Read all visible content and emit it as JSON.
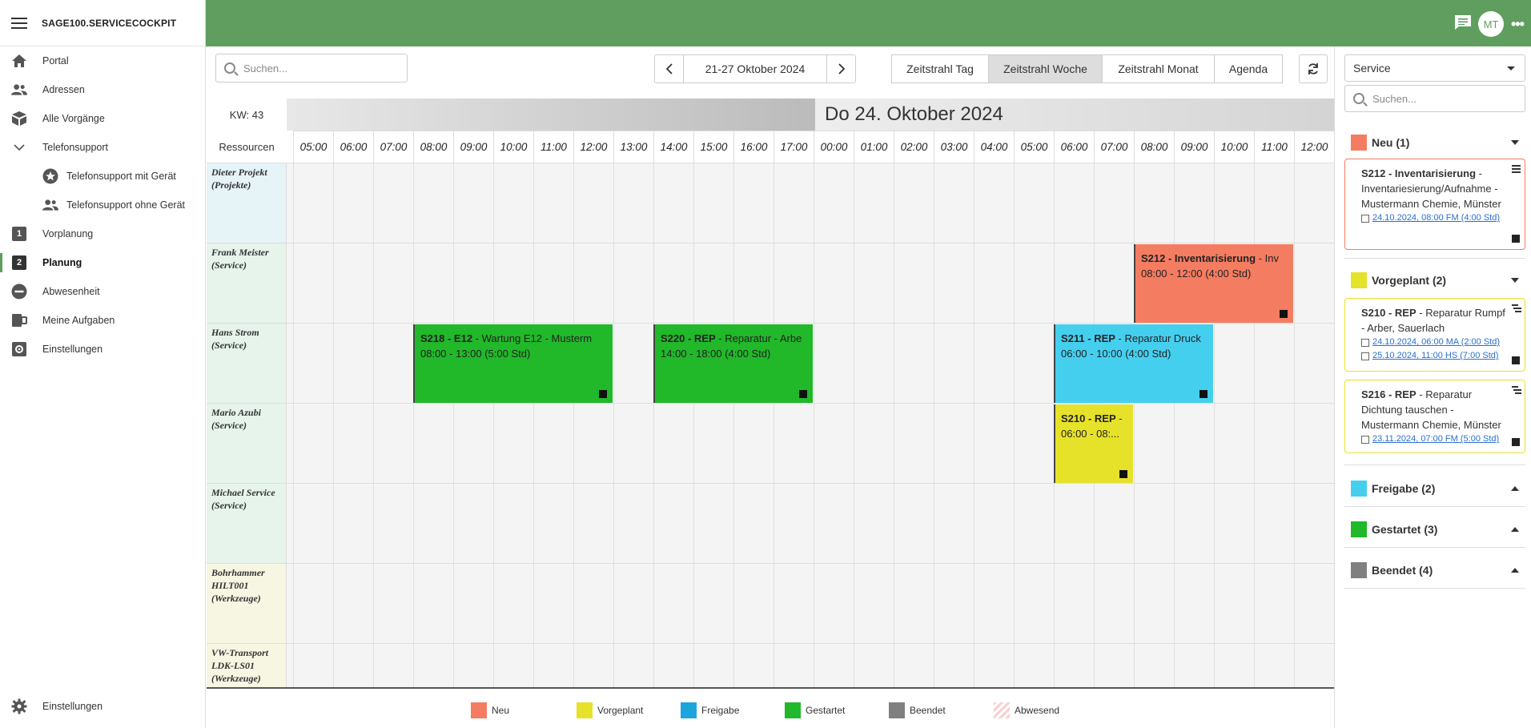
{
  "app": {
    "title": "SAGE100.SERVICECOCKPIT",
    "user_initials": "MT"
  },
  "sidebar": {
    "items": [
      {
        "label": "Portal",
        "icon": "home-icon"
      },
      {
        "label": "Adressen",
        "icon": "people-icon"
      },
      {
        "label": "Alle Vorgänge",
        "icon": "box-icon"
      },
      {
        "label": "Telefonsupport",
        "icon": "chevron-down-icon"
      },
      {
        "label": "Telefonsupport mit Gerät",
        "icon": "star-circle-icon"
      },
      {
        "label": "Telefonsupport ohne Gerät",
        "icon": "people-icon"
      },
      {
        "label": "Vorplanung",
        "icon": "number-1-icon",
        "num": "1"
      },
      {
        "label": "Planung",
        "icon": "number-2-icon",
        "num": "2"
      },
      {
        "label": "Abwesenheit",
        "icon": "minus-circle-icon"
      },
      {
        "label": "Meine Aufgaben",
        "icon": "tasks-icon"
      },
      {
        "label": "Einstellungen",
        "icon": "settings-icon"
      }
    ],
    "footer_label": "Einstellungen"
  },
  "toolbar": {
    "search_placeholder": "Suchen...",
    "date_range": "21-27 Oktober 2024",
    "views": [
      "Zeitstrahl Tag",
      "Zeitstrahl Woche",
      "Zeitstrahl Monat",
      "Agenda"
    ],
    "active_view": "Zeitstrahl Woche"
  },
  "calendar": {
    "kw": "KW: 43",
    "resources_label": "Ressourcen",
    "current_day": "Do 24. Oktober 2024",
    "hours": [
      "05:00",
      "06:00",
      "07:00",
      "08:00",
      "09:00",
      "10:00",
      "11:00",
      "12:00",
      "13:00",
      "14:00",
      "15:00",
      "16:00",
      "17:00",
      "00:00",
      "01:00",
      "02:00",
      "03:00",
      "04:00",
      "05:00",
      "06:00",
      "07:00",
      "08:00",
      "09:00",
      "10:00",
      "11:00",
      "12:00"
    ],
    "resources": [
      {
        "name": "Dieter Projekt (Projekte)",
        "kind": "proj"
      },
      {
        "name": "Frank Meister (Service)",
        "kind": "serv"
      },
      {
        "name": "Hans Strom (Service)",
        "kind": "serv"
      },
      {
        "name": "Mario Azubi (Service)",
        "kind": "serv"
      },
      {
        "name": "Michael Service (Service)",
        "kind": "serv"
      },
      {
        "name": "Bohrhammer HILT001 (Werkzeuge)",
        "kind": "tool"
      },
      {
        "name": "VW-Transport LDK-LS01 (Werkzeuge)",
        "kind": "tool"
      }
    ],
    "events": [
      {
        "id": "S212 - Inventarisierung",
        "desc": " - Inv",
        "time": "08:00 - 12:00 (4:00 Std)",
        "color": "#f47c61",
        "row": 1
      },
      {
        "id": "S218 - E12",
        "desc": " - Wartung E12 - Musterm",
        "time": "08:00 - 13:00 (5:00 Std)",
        "color": "#21b82a",
        "row": 2
      },
      {
        "id": "S220 - REP",
        "desc": " - Reparatur - Arbe",
        "time": "14:00 - 18:00 (4:00 Std)",
        "color": "#21b82a",
        "row": 2
      },
      {
        "id": "S211 - REP",
        "desc": " - Reparatur Druck",
        "time": "06:00 - 10:00 (4:00 Std)",
        "color": "#45cfef",
        "row": 2
      },
      {
        "id": "S210 - REP",
        "desc": " -",
        "time": "06:00 - 08:...",
        "color": "#e6e22a",
        "row": 3
      }
    ]
  },
  "legend": [
    {
      "label": "Neu",
      "color": "#f47c61"
    },
    {
      "label": "Vorgeplant",
      "color": "#e6e22a"
    },
    {
      "label": "Freigabe",
      "color": "#1ea4dc"
    },
    {
      "label": "Gestartet",
      "color": "#21b82a"
    },
    {
      "label": "Beendet",
      "color": "#808080"
    },
    {
      "label": "Abwesend",
      "color": "#f5c6c6"
    }
  ],
  "right_panel": {
    "filter_value": "Service",
    "search_placeholder": "Suchen...",
    "groups": [
      {
        "label": "Neu (1)",
        "color": "#f47c61",
        "expanded": true
      },
      {
        "label": "Vorgeplant (2)",
        "color": "#e6e22a",
        "expanded": true
      },
      {
        "label": "Freigabe (2)",
        "color": "#45cfef",
        "expanded": false
      },
      {
        "label": "Gestartet (3)",
        "color": "#21b82a",
        "expanded": false
      },
      {
        "label": "Beendet (4)",
        "color": "#808080",
        "expanded": false
      }
    ],
    "cards": [
      {
        "title": "S212 - Inventarisierung",
        "text": " - Inventariesierung/Aufnahme - Mustermann Chemie, Münster",
        "links": [
          "24.10.2024, 08:00 FM (4:00 Std)"
        ]
      },
      {
        "title": "S210 - REP",
        "text": " - Reparatur Rumpf - Arber, Sauerlach",
        "links": [
          "24.10.2024, 06:00 MA (2:00 Std)",
          "25.10.2024, 11:00 HS (7:00 Std)"
        ]
      },
      {
        "title": "S216 - REP",
        "text": " - Reparatur Dichtung tauschen - Mustermann Chemie, Münster",
        "links": [
          "23.11.2024, 07:00 FM (5:00 Std)"
        ]
      }
    ]
  }
}
